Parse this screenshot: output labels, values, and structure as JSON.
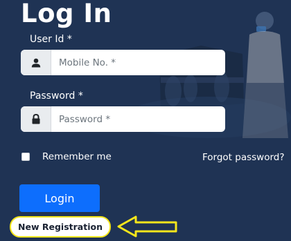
{
  "title": "Log In",
  "user_field": {
    "label": "User Id *",
    "placeholder": "Mobile No. *",
    "icon": "user-icon"
  },
  "password_field": {
    "label": "Password *",
    "placeholder": "Password *",
    "icon": "lock-icon"
  },
  "remember": {
    "label": "Remember me",
    "checked": false
  },
  "forgot_link": "Forgot password?",
  "login_button": "Login",
  "new_registration": "New Registration",
  "colors": {
    "background": "#1f3354",
    "primary": "#0d6efd",
    "highlight": "#f5e61b"
  }
}
